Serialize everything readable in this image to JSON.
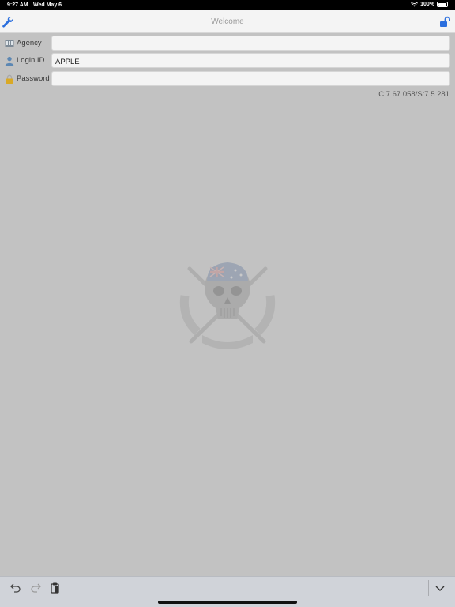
{
  "status_bar": {
    "time": "9:27 AM",
    "date": "Wed May 6",
    "battery": "100%",
    "battery_level": 1.0
  },
  "nav": {
    "title": "Welcome",
    "left_icon": "wrench-icon",
    "right_icon": "unlocked-padlock-icon"
  },
  "form": {
    "agency": {
      "label": "Agency",
      "value": "",
      "icon": "building-icon"
    },
    "login": {
      "label": "Login ID",
      "value": "APPLE",
      "icon": "person-icon"
    },
    "password": {
      "label": "Password",
      "value": "",
      "icon": "padlock-icon"
    }
  },
  "version": "C:7.67.058/S:7.5.281",
  "toolbar": {
    "undo_icon": "undo-icon",
    "redo_icon": "redo-icon",
    "paste_icon": "clipboard-icon",
    "dismiss_icon": "chevron-down-icon"
  },
  "colors": {
    "accent": "#2b6fde",
    "background": "#c2c2c2",
    "navbar": "#f4f4f4"
  }
}
